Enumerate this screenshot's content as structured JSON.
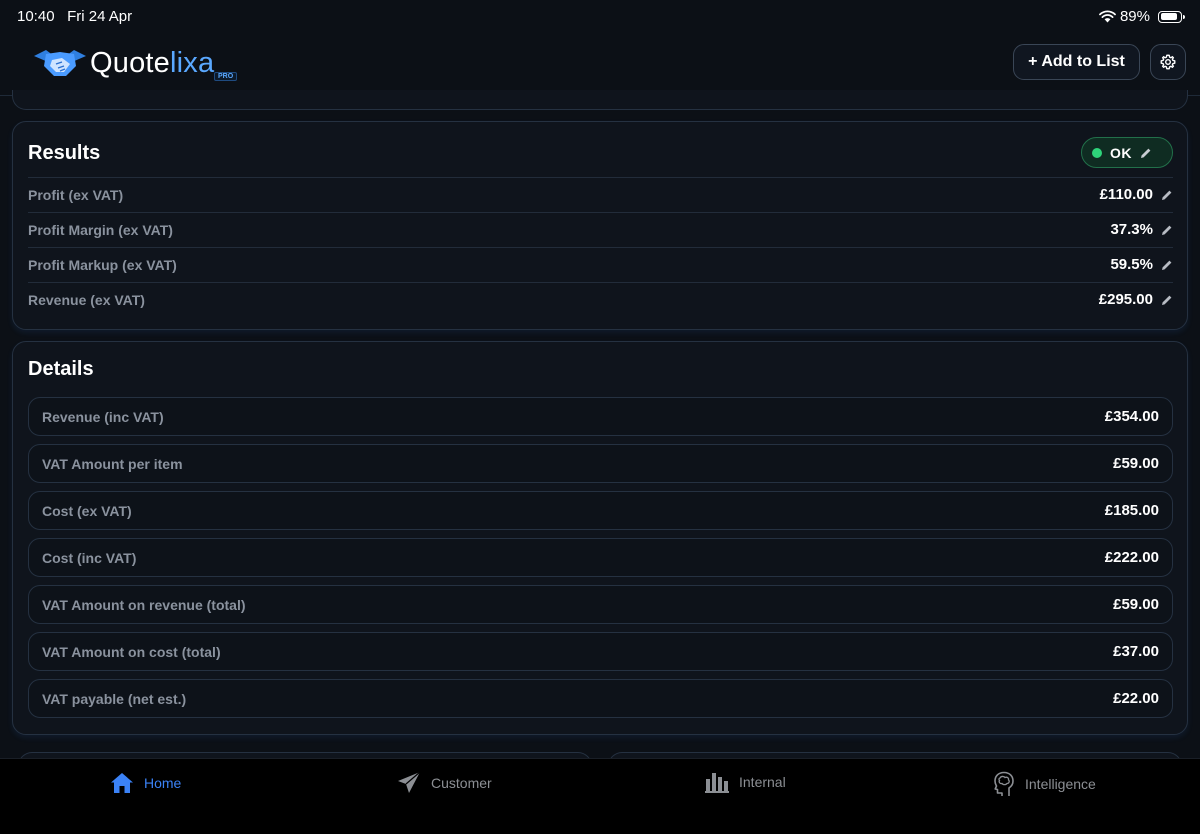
{
  "status_bar": {
    "time": "10:40",
    "date": "Fri 24 Apr",
    "battery": "89%",
    "battery_level": 0.89
  },
  "header": {
    "logo_text_a": "Quote",
    "logo_text_b": "lixa",
    "logo_badge": "PRO",
    "add_button_label": "+ Add to List",
    "settings_icon": "gear-icon"
  },
  "results": {
    "title": "Results",
    "status": "OK",
    "status_color": "#2ed47a",
    "rows": [
      {
        "label": "Profit (ex VAT)",
        "value": "£110.00"
      },
      {
        "label": "Profit Margin (ex VAT)",
        "value": "37.3%"
      },
      {
        "label": "Profit Markup (ex VAT)",
        "value": "59.5%"
      },
      {
        "label": "Revenue (ex VAT)",
        "value": "£295.00"
      }
    ]
  },
  "details": {
    "title": "Details",
    "rows": [
      {
        "label": "Revenue (inc VAT)",
        "value": "£354.00"
      },
      {
        "label": "VAT Amount per item",
        "value": "£59.00"
      },
      {
        "label": "Cost (ex VAT)",
        "value": "£185.00"
      },
      {
        "label": "Cost (inc VAT)",
        "value": "£222.00"
      },
      {
        "label": "VAT Amount on revenue (total)",
        "value": "£59.00"
      },
      {
        "label": "VAT Amount on cost (total)",
        "value": "£37.00"
      },
      {
        "label": "VAT payable (net est.)",
        "value": "£22.00"
      }
    ]
  },
  "tabs": [
    {
      "label": "Home",
      "icon": "home-icon",
      "active": true
    },
    {
      "label": "Customer",
      "icon": "paper-plane-icon",
      "active": false
    },
    {
      "label": "Internal",
      "icon": "bar-chart-icon",
      "active": false
    },
    {
      "label": "Intelligence",
      "icon": "brain-head-icon",
      "active": false
    }
  ],
  "colors": {
    "background": "#0c1016",
    "accent": "#3b82f6",
    "ok_green": "#2ed47a"
  }
}
